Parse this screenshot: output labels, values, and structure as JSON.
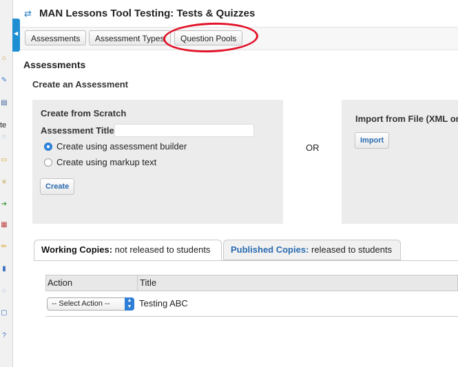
{
  "app": {
    "title": "MAN Lessons Tool Testing: Tests & Quizzes",
    "title_icon": "refresh-icon"
  },
  "sidebar": {
    "partial_label_1": "te",
    "icons": [
      "home-icon",
      "pin-icon",
      "book-icon",
      "chat-icon",
      "folder-icon",
      "inbox-icon",
      "export-icon",
      "document-icon",
      "pencil-icon",
      "chart-icon",
      "chat-icon",
      "window-icon",
      "help-icon"
    ]
  },
  "nav": {
    "items": [
      "Assessments",
      "Assessment Types",
      "Question Pools"
    ]
  },
  "page": {
    "heading": "Assessments",
    "subheading": "Create an Assessment"
  },
  "scratch": {
    "title": "Create from Scratch",
    "assessment_title_label": "Assessment Title",
    "assessment_title_value": "",
    "options": [
      {
        "label": "Create using assessment builder",
        "selected": true
      },
      {
        "label": "Create using markup text",
        "selected": false
      }
    ],
    "create_button": "Create"
  },
  "or_label": "OR",
  "import": {
    "title": "Import from File (XML or",
    "button": "Import"
  },
  "tabs": [
    {
      "key": "Working Copies:",
      "desc": "not released to students",
      "active": true
    },
    {
      "key": "Published Copies:",
      "desc": "released to students",
      "active": false
    }
  ],
  "table": {
    "headers": [
      "Action",
      "Title"
    ],
    "rows": [
      {
        "action": "-- Select Action --",
        "title": "Testing ABC"
      }
    ]
  },
  "colors": {
    "accent": "#1f8fd3",
    "annotation": "#e3132a",
    "link": "#2a6bb0"
  }
}
